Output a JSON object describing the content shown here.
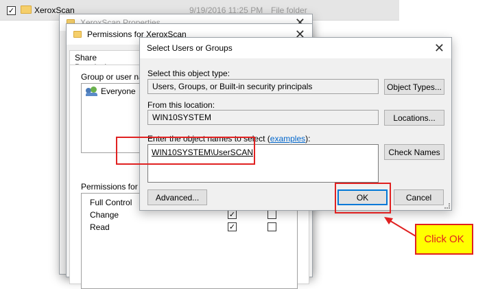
{
  "explorer": {
    "folder_name": "XeroxScan",
    "date_modified": "9/19/2016 11:25 PM",
    "item_type": "File folder"
  },
  "properties_dialog": {
    "title": "XeroxScan Properties"
  },
  "permissions_dialog": {
    "title": "Permissions for XeroxScan",
    "tab": "Share Permissions",
    "group_label": "Group or user nam",
    "group_items": [
      "Everyone"
    ],
    "permissions_label": "Permissions for Ev",
    "permissions": [
      {
        "name": "Full Control",
        "allow": false,
        "deny": false
      },
      {
        "name": "Change",
        "allow": true,
        "deny": false
      },
      {
        "name": "Read",
        "allow": true,
        "deny": false
      }
    ]
  },
  "select_dialog": {
    "title": "Select Users or Groups",
    "object_type_label": "Select this object type:",
    "object_type_value": "Users, Groups, or Built-in security principals",
    "object_types_button": "Object Types...",
    "location_label": "From this location:",
    "location_value": "WIN10SYSTEM",
    "locations_button": "Locations...",
    "names_label_prefix": "Enter the object names to select (",
    "names_label_link": "examples",
    "names_label_suffix": "):",
    "names_value": "WIN10SYSTEM\\UserSCAN",
    "check_names_button": "Check Names",
    "advanced_button": "Advanced...",
    "ok_button": "OK",
    "cancel_button": "Cancel"
  },
  "annotation": {
    "callout_text": "Click OK",
    "color": "#e02020",
    "callout_bg": "#ffff00"
  }
}
